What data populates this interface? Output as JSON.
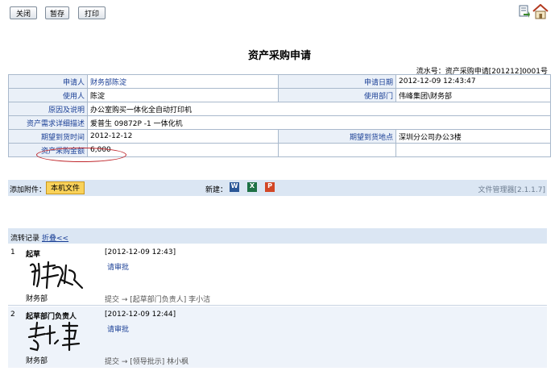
{
  "toolbar": {
    "close_label": "关闭",
    "save_draft_label": "暂存",
    "print_label": "打印"
  },
  "page_title": "资产采购申请",
  "serial": {
    "label": "流水号：",
    "value": "资产采购申请[201212]0001号"
  },
  "form": {
    "applicant": {
      "label": "申请人",
      "value": "财务部陈淀"
    },
    "apply_date": {
      "label": "申请日期",
      "value": "2012-12-09 12:43:47"
    },
    "user": {
      "label": "使用人",
      "value": "陈淀"
    },
    "dept": {
      "label": "使用部门",
      "value": "伟峰集团\\财务部"
    },
    "reason": {
      "label": "原因及说明",
      "value": "办公室购买一体化全自动打印机"
    },
    "detail": {
      "label": "资产需求详细描述",
      "value": "爱普生 09872P -1 一体化机"
    },
    "expected_time": {
      "label": "期望到货时间",
      "value": "2012-12-12"
    },
    "expected_place": {
      "label": "期望到货地点",
      "value": "深圳分公司办公3楼"
    },
    "amount": {
      "label": "资产采购金额",
      "value": "6,000"
    }
  },
  "attachments": {
    "label": "添加附件：",
    "local_file_label": "本机文件",
    "new_label": "新建：",
    "file_manager_label": "文件管理器[2.1.1.7]",
    "icons": [
      "word-icon",
      "excel-icon",
      "ppt-icon"
    ],
    "colors": {
      "word": "#2b5797",
      "excel": "#1e7145",
      "ppt": "#d24726"
    }
  },
  "flow": {
    "title": "流转记录",
    "fold_label": "折叠<<",
    "records": [
      {
        "num": "1",
        "role": "起草",
        "dept": "财务部",
        "time": "[2012-12-09 12:43]",
        "approval": "请审批",
        "submit": "提交 → [起草部门负责人] 李小洁"
      },
      {
        "num": "2",
        "role": "起草部门负责人",
        "dept": "财务部",
        "time": "[2012-12-09 12:44]",
        "approval": "请审批",
        "submit": "提交 → [领导批示] 林小枫"
      }
    ]
  }
}
